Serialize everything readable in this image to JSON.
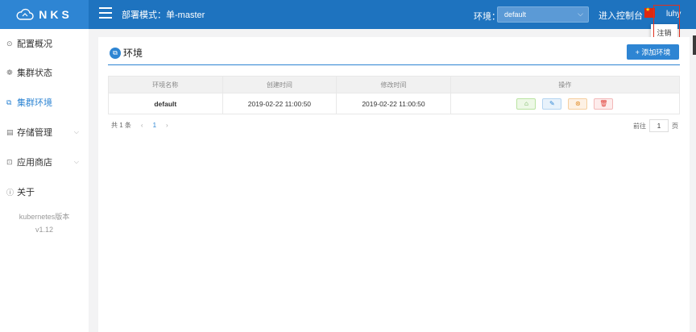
{
  "header": {
    "brand": "NKS",
    "deploy_mode": "部署模式：单-master",
    "env_label": "环境：",
    "env_selected": "default",
    "console_link": "进入控制台",
    "user": "luhy",
    "dropdown_item": "注销"
  },
  "sidebar": {
    "items": [
      {
        "label": "配置概况",
        "icon": "gear-circle-icon"
      },
      {
        "label": "集群状态",
        "icon": "cluster-icon"
      },
      {
        "label": "集群环境",
        "icon": "environment-icon"
      },
      {
        "label": "存储管理",
        "icon": "storage-icon"
      },
      {
        "label": "应用商店",
        "icon": "store-icon"
      },
      {
        "label": "关于",
        "icon": "info-icon"
      }
    ],
    "version_label": "kubernetes版本",
    "version_value": "v1.12"
  },
  "main": {
    "title": "环境",
    "add_button": "+ 添加环境",
    "columns": [
      "环境名称",
      "创建时间",
      "修改时间",
      "操作"
    ],
    "rows": [
      {
        "name": "default",
        "created": "2019-02-22 11:00:50",
        "modified": "2019-02-22 11:00:50"
      }
    ],
    "pager": {
      "total": "共 1 条",
      "prev": "‹",
      "page": "1",
      "next": "›"
    },
    "goto": {
      "label": "前往",
      "value": "1",
      "suffix": "页"
    }
  },
  "colors": {
    "topbar": "#1e73bf",
    "brand_bg": "#2e85d3",
    "accent": "#2e85d3"
  }
}
